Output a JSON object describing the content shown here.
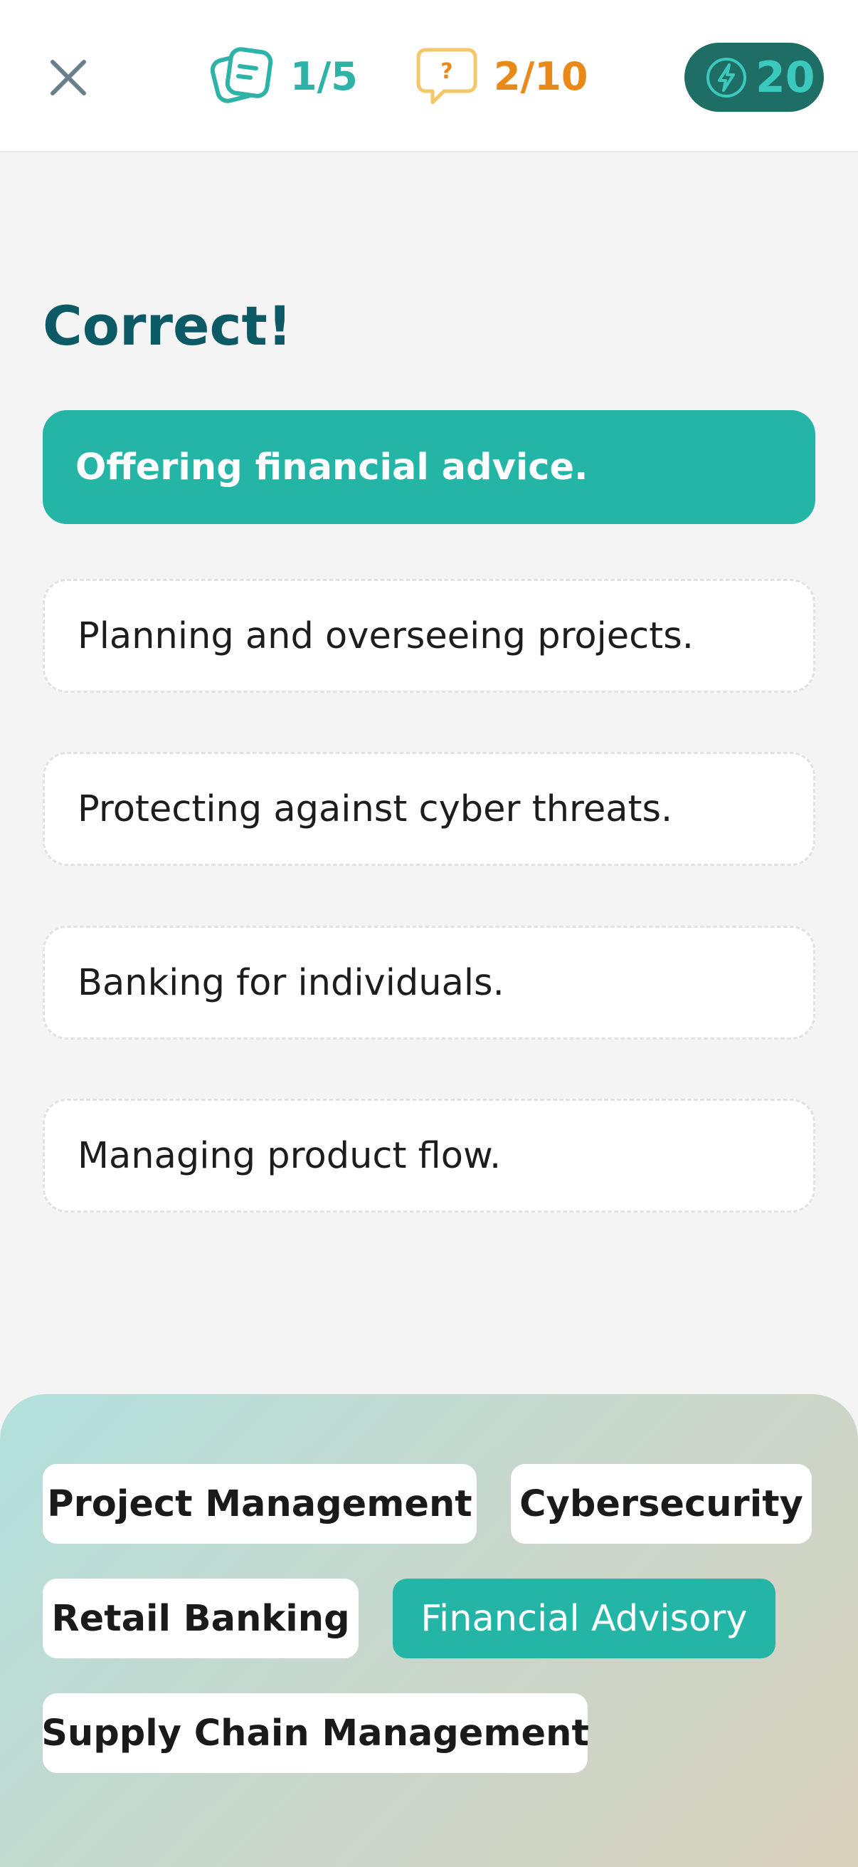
{
  "header": {
    "close_icon": "close-icon",
    "cards": {
      "icon": "cards-icon",
      "progress": "1/5",
      "color": "#2db3a8"
    },
    "questions": {
      "icon": "question-bubble-icon",
      "progress": "2/10",
      "color": "#e8891a"
    },
    "energy": {
      "icon": "lightning-icon",
      "value": "20",
      "bg": "#1e6e66"
    }
  },
  "feedback": {
    "title": "Correct!",
    "color": "#0c5a65"
  },
  "options": [
    {
      "label": "Offering financial advice.",
      "state": "correct"
    },
    {
      "label": "Planning and overseeing projects.",
      "state": "default"
    },
    {
      "label": "Protecting against cyber threats.",
      "state": "default"
    },
    {
      "label": "Banking for individuals.",
      "state": "default"
    },
    {
      "label": "Managing product flow.",
      "state": "default"
    }
  ],
  "categories": [
    {
      "label": "Project Management",
      "selected": false
    },
    {
      "label": "Cybersecurity",
      "selected": false
    },
    {
      "label": "Retail Banking",
      "selected": false
    },
    {
      "label": "Financial Advisory",
      "selected": true
    },
    {
      "label": "Supply Chain Management",
      "selected": false
    }
  ],
  "colors": {
    "accent": "#25b5a7",
    "background": "#f4f4f4"
  }
}
